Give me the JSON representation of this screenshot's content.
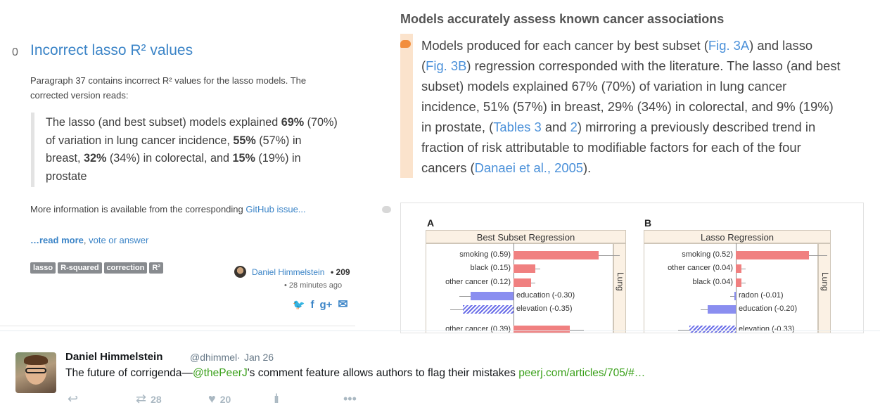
{
  "question": {
    "votes": "0",
    "title": "Incorrect lasso R² values",
    "desc_line1": "Paragraph 37 contains incorrect R² values for the lasso models. The",
    "desc_line2": "corrected version reads:",
    "quote": [
      {
        "t1": "The lasso (and best subset) models explained ",
        "b": "69%",
        "t2": " (70%)"
      },
      {
        "t1": "of variation in lung cancer incidence, ",
        "b": "55%",
        "t2": " (57%) in"
      },
      {
        "t1": "breast, ",
        "b": "32%",
        "t2": " (34%) in colorectal, and "
      },
      {
        "t1": "prostate",
        "b": "",
        "t2": ""
      }
    ],
    "quote_l3b2": "15%",
    "quote_l3t3": " (19%) in",
    "more_info_prefix": "More information is available from the corresponding ",
    "more_info_link": "GitHub issue...",
    "read_more": "…read more",
    "read_more_sep": ", ",
    "vote_answer": "vote or answer",
    "tags": [
      "lasso",
      "R-squared",
      "correction",
      "R²"
    ],
    "author": "Daniel Himmelstein",
    "author_rep": "• 209",
    "time": "• 28 minutes ago",
    "share_icons": [
      "twitter-icon",
      "facebook-icon",
      "google-plus-icon",
      "email-icon"
    ],
    "share_glyphs": [
      "🐦",
      "f",
      "g+",
      "✉"
    ]
  },
  "article": {
    "heading": "Models accurately assess known cancer associations",
    "para_lines": [
      [
        {
          "t": "Models produced for each cancer by best subset ("
        },
        {
          "l": "Fig. 3A"
        },
        {
          "t": ") and lasso"
        }
      ],
      [
        {
          "t": "("
        },
        {
          "l": "Fig. 3B"
        },
        {
          "t": ") regression corresponded with the literature. The lasso (and best"
        }
      ],
      [
        {
          "t": "subset) models explained 67% (70%) of variation in lung cancer"
        }
      ],
      [
        {
          "t": "incidence, 51% (57%) in breast, 29% (34%) in colorectal, and 9% (19%)"
        }
      ],
      [
        {
          "t": "in prostate, ("
        },
        {
          "l": "Tables 3"
        },
        {
          "t": " and "
        },
        {
          "l": "2"
        },
        {
          "t": ") mirroring a previously described trend in"
        }
      ],
      [
        {
          "t": "fraction of risk attributable to modifiable factors for each of the four"
        }
      ],
      [
        {
          "t": "cancers ("
        },
        {
          "l": "Danaei et al., 2005"
        },
        {
          "t": ")."
        }
      ]
    ]
  },
  "figure": {
    "panel_a": "A",
    "panel_b": "B",
    "title_a": "Best Subset Regression",
    "title_b": "Lasso Regression",
    "strip": "Lung",
    "rows_a": [
      {
        "label": "smoking (0.59)",
        "value": 0.59
      },
      {
        "label": "black (0.15)",
        "value": 0.15
      },
      {
        "label": "other cancer (0.12)",
        "value": 0.12
      },
      {
        "label": "education (-0.30)",
        "value": -0.3
      },
      {
        "label": "elevation (-0.35)",
        "value": -0.35,
        "hatched": true
      },
      {
        "label": "other cancer (0.39)",
        "value": 0.39
      }
    ],
    "rows_b": [
      {
        "label": "smoking (0.52)",
        "value": 0.52
      },
      {
        "label": "other cancer (0.04)",
        "value": 0.04
      },
      {
        "label": "black (0.04)",
        "value": 0.04
      },
      {
        "label": "radon (-0.01)",
        "value": -0.01
      },
      {
        "label": "education (-0.20)",
        "value": -0.2
      },
      {
        "label": "elevation (-0.33)",
        "value": -0.33,
        "hatched": true
      }
    ]
  },
  "tweet": {
    "name": "Daniel Himmelstein",
    "handle": "@dhimmel",
    "dot": "·",
    "date": "Jan 26",
    "text_1": "The future of corrigenda—",
    "mention": "@thePeerJ",
    "text_2": "'s comment feature allows authors to flag their mistakes ",
    "link": "peerj.com/articles/705/#…",
    "retweets": "28",
    "likes": "20"
  }
}
